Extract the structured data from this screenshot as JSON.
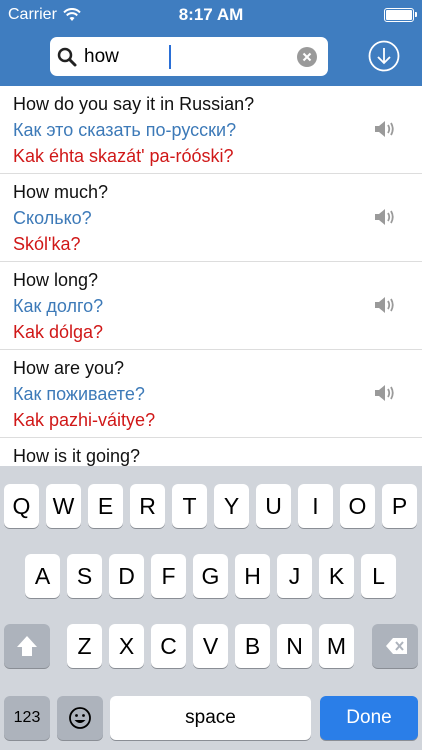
{
  "status": {
    "carrier": "Carrier",
    "time": "8:17 AM",
    "battery_level": 1.0
  },
  "search": {
    "value": "how",
    "placeholder": ""
  },
  "results": [
    {
      "english": "How do you say it in Russian?",
      "russian": "Как это сказать по-русски?",
      "transliteration": "Kak éhta skazát' pa-róóski?"
    },
    {
      "english": "How much?",
      "russian": "Сколько?",
      "transliteration": "Skól'ka?"
    },
    {
      "english": "How long?",
      "russian": "Как долго?",
      "transliteration": "Kak dólga?"
    },
    {
      "english": "How are you?",
      "russian": "Как поживаете?",
      "transliteration": "Kak pazhi-váitye?"
    },
    {
      "english": "How is it going?",
      "russian": "",
      "transliteration": ""
    }
  ],
  "keyboard": {
    "row1": [
      "Q",
      "W",
      "E",
      "R",
      "T",
      "Y",
      "U",
      "I",
      "O",
      "P"
    ],
    "row2": [
      "A",
      "S",
      "D",
      "F",
      "G",
      "H",
      "J",
      "K",
      "L"
    ],
    "row3": [
      "Z",
      "X",
      "C",
      "V",
      "B",
      "N",
      "M"
    ],
    "numbers_label": "123",
    "space_label": "space",
    "done_label": "Done"
  },
  "colors": {
    "header": "#3f7dc0",
    "english": "#111111",
    "russian": "#3d7ab8",
    "transliteration": "#d01818",
    "done": "#2a7ee8"
  }
}
